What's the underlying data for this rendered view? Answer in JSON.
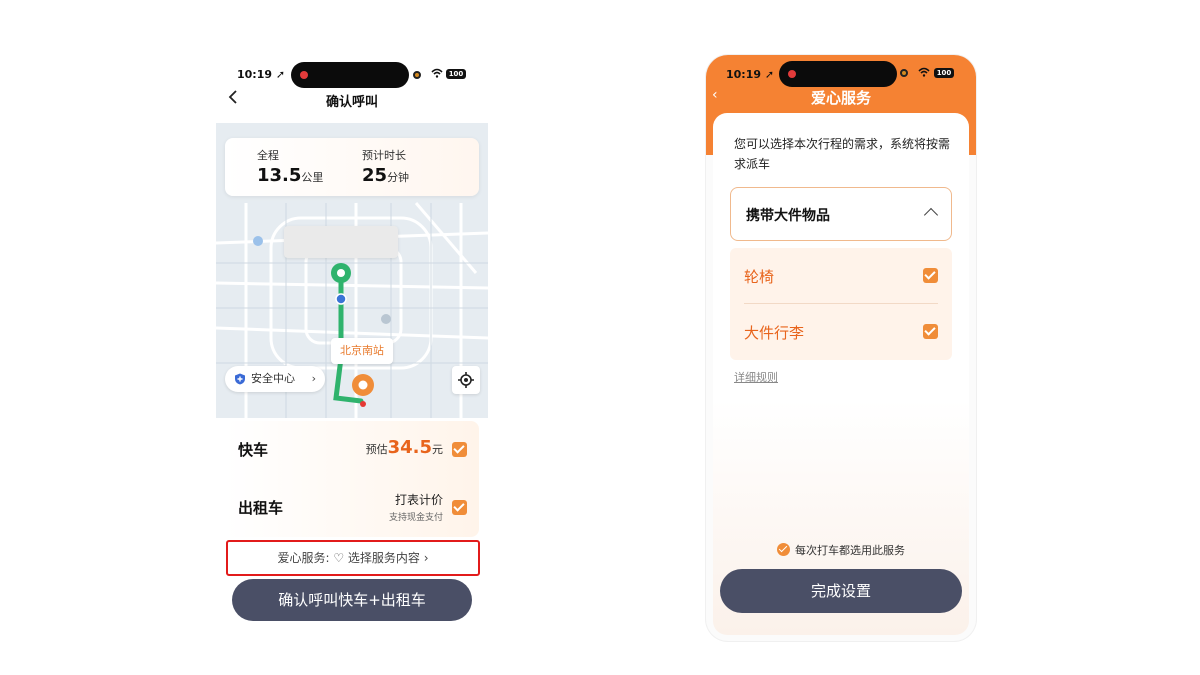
{
  "left_screen": {
    "status": {
      "time": "10:19 ➚",
      "battery": "100"
    },
    "nav": {
      "back_icon": "chevron-left-icon",
      "title": "确认呼叫"
    },
    "trip": {
      "distance_label": "全程",
      "distance_value": "13.5",
      "distance_unit": "公里",
      "duration_label": "预计时长",
      "duration_value": "25",
      "duration_unit": "分钟"
    },
    "map": {
      "destination_label": "北京南站",
      "safety_label": "安全中心"
    },
    "rides": [
      {
        "name": "快车",
        "price_prefix": "预估",
        "price": "34.5",
        "price_unit": "元",
        "checked": true
      },
      {
        "name": "出租车",
        "meter_title": "打表计价",
        "meter_sub": "支持现金支付",
        "checked": true
      }
    ],
    "care_service": {
      "label": "爱心服务: ♡ 选择服务内容 ›"
    },
    "confirm_button": "确认呼叫快车+出租车"
  },
  "right_screen": {
    "status": {
      "time": "10:19 ➚",
      "battery": "100"
    },
    "nav": {
      "back": "‹",
      "title": "爱心服务"
    },
    "intro": "您可以选择本次行程的需求，系统将按需求派车",
    "category": {
      "label": "携带大件物品",
      "expanded": true
    },
    "options": [
      {
        "label": "轮椅",
        "checked": true
      },
      {
        "label": "大件行李",
        "checked": true
      }
    ],
    "rules_link": "详细规则",
    "remember_label": "每次打车都选用此服务",
    "done_button": "完成设置"
  },
  "colors": {
    "accent_orange": "#f08d39",
    "header_orange": "#f58233",
    "price_orange": "#e8641c",
    "button_dark": "#4a4f66",
    "route_green": "#2fb36d",
    "highlight_red": "#e21b1b"
  }
}
